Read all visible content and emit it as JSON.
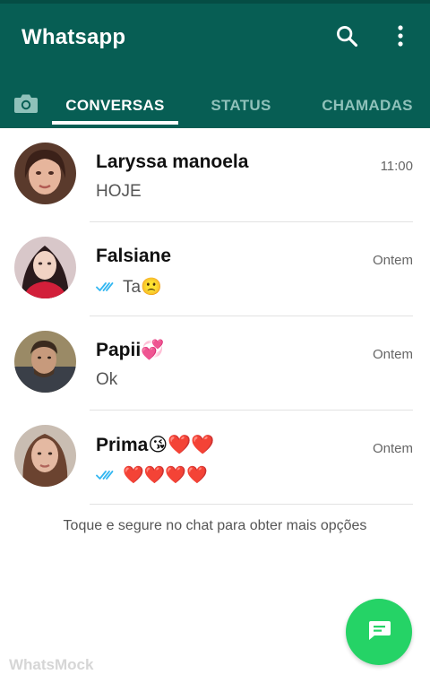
{
  "app": {
    "title": "Whatsapp",
    "colors": {
      "header": "#075e54",
      "accent": "#25d366",
      "tick": "#34b7f1"
    }
  },
  "header_icons": [
    "search-icon",
    "more-vert-icon",
    "camera-icon"
  ],
  "tabs": [
    {
      "label": "CONVERSAS",
      "active": true
    },
    {
      "label": "STATUS",
      "active": false
    },
    {
      "label": "CHAMADAS",
      "active": false
    }
  ],
  "chats": [
    {
      "name": "Laryssa manoela",
      "time": "11:00",
      "preview": "HOJE",
      "read_ticks": false
    },
    {
      "name": "Falsiane",
      "time": "Ontem",
      "preview": "Ta🙁",
      "read_ticks": true
    },
    {
      "name": "Papii💞",
      "time": "Ontem",
      "preview": "Ok",
      "read_ticks": false
    },
    {
      "name": "Prima😘❤️❤️",
      "time": "Ontem",
      "preview": "❤️❤️❤️❤️",
      "read_ticks": true
    }
  ],
  "hint": "Toque e segure no chat para obter mais opções",
  "watermark": "WhatsMock",
  "fab_icon": "new-chat-icon"
}
